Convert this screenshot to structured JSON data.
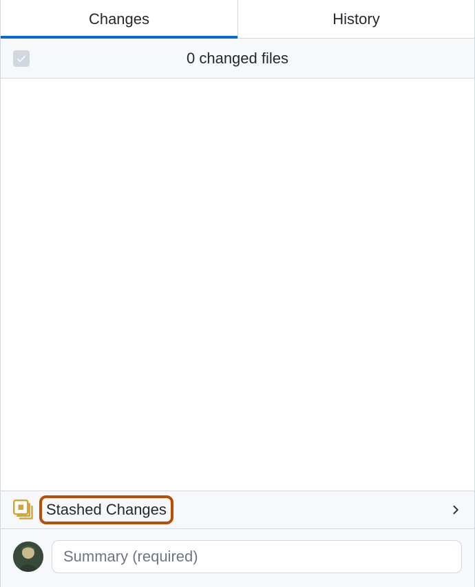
{
  "tabs": {
    "changes_label": "Changes",
    "history_label": "History",
    "active": "changes"
  },
  "changes_header": {
    "count_text": "0 changed files"
  },
  "stash": {
    "label": "Stashed Changes"
  },
  "commit": {
    "summary_placeholder": "Summary (required)"
  },
  "colors": {
    "accent": "#0969da",
    "highlight_border": "#bc4c00",
    "stash_icon": "#d4a72c",
    "bg_subtle": "#f6f8fa",
    "border": "#d0d7de"
  }
}
